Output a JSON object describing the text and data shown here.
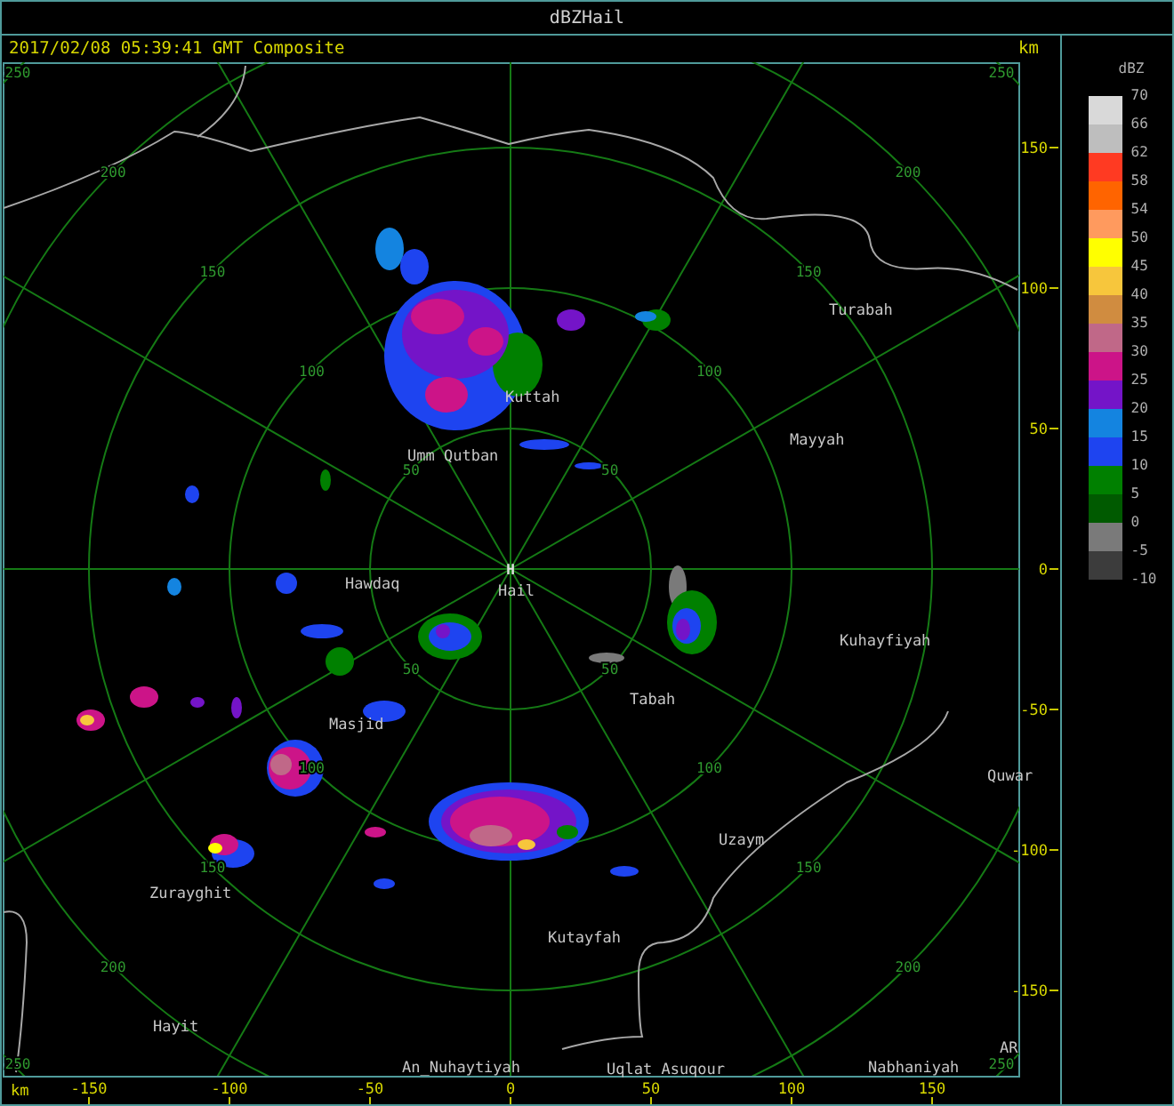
{
  "window": {
    "title": "dBZHail"
  },
  "header": {
    "timestamp": "2017/02/08 05:39:41 GMT Composite",
    "units": "km"
  },
  "map": {
    "center_marker": "H",
    "range_labels": [
      [
        "250",
        "250"
      ],
      [
        "200",
        "200"
      ],
      [
        "150",
        "150"
      ],
      [
        "100",
        "100"
      ],
      [
        "50",
        "50"
      ],
      [
        "50",
        "50"
      ],
      [
        "100",
        "100"
      ],
      [
        "150",
        "150"
      ],
      [
        "200",
        "200"
      ],
      [
        "250",
        "250"
      ]
    ],
    "places": [
      {
        "name": "Turabah"
      },
      {
        "name": "Kuttah"
      },
      {
        "name": "Mayyah"
      },
      {
        "name": "Umm Qutban"
      },
      {
        "name": "Hawdaq"
      },
      {
        "name": "Hail"
      },
      {
        "name": "Kuhayfiyah"
      },
      {
        "name": "Tabah"
      },
      {
        "name": "Masjid"
      },
      {
        "name": "Quwar"
      },
      {
        "name": "Uzaym"
      },
      {
        "name": "Zurayghit"
      },
      {
        "name": "Kutayfah"
      },
      {
        "name": "Hayit"
      },
      {
        "name": "An_Nuhaytiyah"
      },
      {
        "name": "Uqlat Asuqour"
      },
      {
        "name": "Nabhaniyah"
      },
      {
        "name": "AR"
      }
    ],
    "x_axis": {
      "unit": "km",
      "ticks": [
        "-150",
        "-100",
        "-50",
        "0",
        "50",
        "100",
        "150"
      ]
    },
    "y_axis": {
      "ticks": [
        "150",
        "100",
        "50",
        "0",
        "-50",
        "-100",
        "-150"
      ]
    }
  },
  "legend": {
    "title": "dBZ",
    "labels": [
      "70",
      "66",
      "62",
      "58",
      "54",
      "50",
      "45",
      "40",
      "35",
      "30",
      "25",
      "20",
      "15",
      "10",
      "5",
      "0",
      "-5",
      "-10"
    ],
    "bins": [
      {
        "color": "#d9d9d9"
      },
      {
        "color": "#bebebe"
      },
      {
        "color": "#ff3a22"
      },
      {
        "color": "#ff6400"
      },
      {
        "color": "#ff9a5e"
      },
      {
        "color": "#ffff00"
      },
      {
        "color": "#f7c63c"
      },
      {
        "color": "#d08c40"
      },
      {
        "color": "#c06888"
      },
      {
        "color": "#cc1488"
      },
      {
        "color": "#7414c8"
      },
      {
        "color": "#1484e0"
      },
      {
        "color": "#1e44f0"
      },
      {
        "color": "#008000"
      },
      {
        "color": "#005a00"
      },
      {
        "color": "#7a7a7a"
      },
      {
        "color": "#3c3c3c"
      }
    ]
  }
}
